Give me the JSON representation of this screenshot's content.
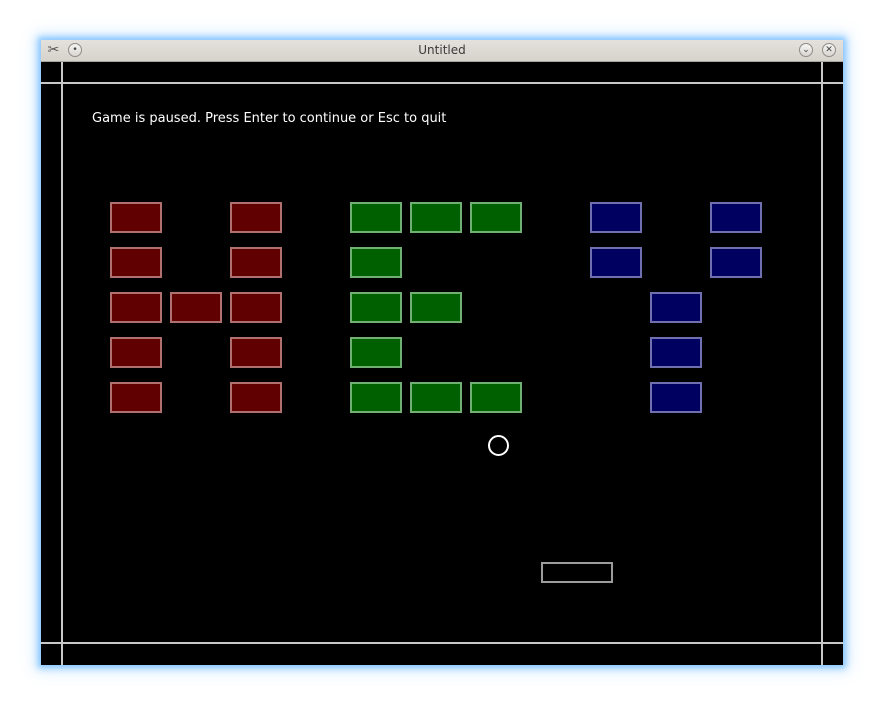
{
  "window": {
    "title": "Untitled",
    "app_icon": "✂",
    "controls": {
      "shade_icon": "•",
      "minimize_icon": "⌄",
      "close_icon": "✕"
    }
  },
  "game": {
    "status_message": "Game is paused. Press Enter to continue or Esc to quit",
    "colors": {
      "background": "#000000",
      "wall": "#c8c8c8",
      "red_fill": "#600000",
      "red_border": "#b07070",
      "green_fill": "#006000",
      "green_border": "#70b070",
      "blue_fill": "#000060",
      "blue_border": "#7070b0",
      "ball": "#ffffff",
      "paddle": "#9c9c9c"
    },
    "bricks": [
      {
        "col": 0,
        "row": 0,
        "color": "red"
      },
      {
        "col": 2,
        "row": 0,
        "color": "red"
      },
      {
        "col": 0,
        "row": 1,
        "color": "red"
      },
      {
        "col": 2,
        "row": 1,
        "color": "red"
      },
      {
        "col": 0,
        "row": 2,
        "color": "red"
      },
      {
        "col": 1,
        "row": 2,
        "color": "red"
      },
      {
        "col": 2,
        "row": 2,
        "color": "red"
      },
      {
        "col": 0,
        "row": 3,
        "color": "red"
      },
      {
        "col": 2,
        "row": 3,
        "color": "red"
      },
      {
        "col": 0,
        "row": 4,
        "color": "red"
      },
      {
        "col": 2,
        "row": 4,
        "color": "red"
      },
      {
        "col": 4,
        "row": 0,
        "color": "green"
      },
      {
        "col": 5,
        "row": 0,
        "color": "green"
      },
      {
        "col": 6,
        "row": 0,
        "color": "green"
      },
      {
        "col": 4,
        "row": 1,
        "color": "green"
      },
      {
        "col": 4,
        "row": 2,
        "color": "green"
      },
      {
        "col": 5,
        "row": 2,
        "color": "green"
      },
      {
        "col": 4,
        "row": 3,
        "color": "green"
      },
      {
        "col": 4,
        "row": 4,
        "color": "green"
      },
      {
        "col": 5,
        "row": 4,
        "color": "green"
      },
      {
        "col": 6,
        "row": 4,
        "color": "green"
      },
      {
        "col": 8,
        "row": 0,
        "color": "blue"
      },
      {
        "col": 10,
        "row": 0,
        "color": "blue"
      },
      {
        "col": 8,
        "row": 1,
        "color": "blue"
      },
      {
        "col": 10,
        "row": 1,
        "color": "blue"
      },
      {
        "col": 9,
        "row": 2,
        "color": "blue"
      },
      {
        "col": 9,
        "row": 3,
        "color": "blue"
      },
      {
        "col": 9,
        "row": 4,
        "color": "blue"
      }
    ]
  }
}
